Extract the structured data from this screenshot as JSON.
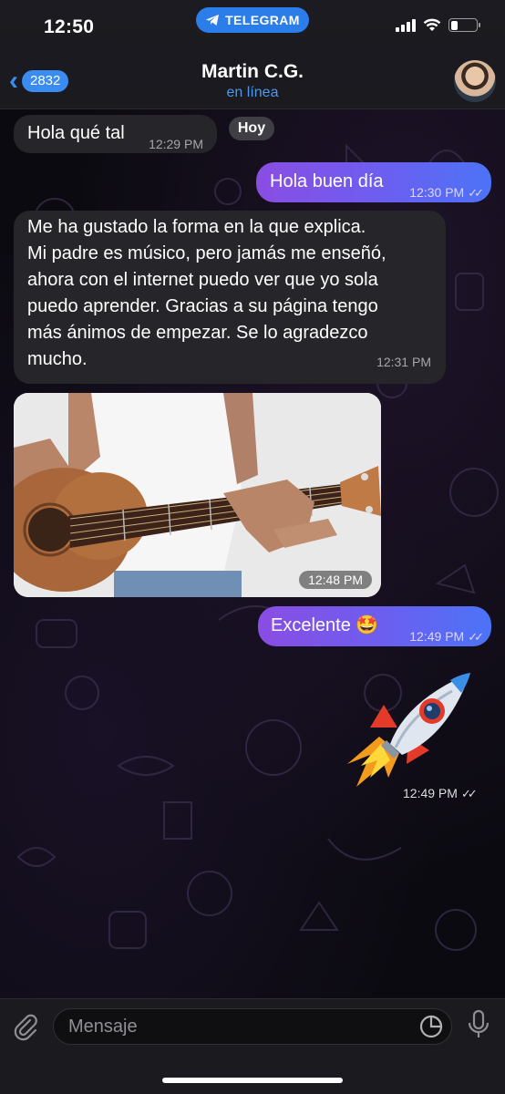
{
  "status_bar": {
    "time": "12:50",
    "app_pill": "TELEGRAM",
    "battery_level": 0.28
  },
  "header": {
    "back_badge": "2832",
    "contact_name": "Martin C.G.",
    "contact_status": "en línea"
  },
  "date_chip": "Hoy",
  "messages": [
    {
      "dir": "in",
      "text": "Hola qué tal",
      "time": "12:29 PM"
    },
    {
      "dir": "out",
      "text": "Hola buen día",
      "time": "12:30 PM"
    },
    {
      "dir": "in",
      "lines": [
        "Me ha gustado la forma en la que explica.",
        "Mi padre es músico, pero jamás me enseñó,",
        "ahora con el internet puedo ver que yo sola",
        "puedo aprender. Gracias a su página tengo",
        "más ánimos de empezar. Se lo agradezco",
        "mucho."
      ],
      "time": "12:31 PM"
    },
    {
      "dir": "in",
      "kind": "photo",
      "time": "12:48 PM"
    },
    {
      "dir": "out",
      "text": "Excelente 🤩",
      "time": "12:49 PM"
    },
    {
      "dir": "out",
      "kind": "sticker",
      "time": "12:49 PM"
    }
  ],
  "composer": {
    "placeholder": "Mensaje"
  },
  "colors": {
    "accent_blue": "#3a8cf0",
    "bubble_in": "#26262a",
    "bubble_out_start": "#8a4de3",
    "bubble_out_end": "#4c73f6"
  }
}
